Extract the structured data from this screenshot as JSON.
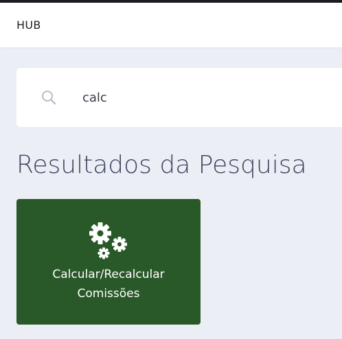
{
  "header": {
    "brand": "HUB"
  },
  "search": {
    "value": "calc",
    "icon": "search-icon"
  },
  "results": {
    "title": "Resultados da Pesquisa",
    "items": [
      {
        "label_line1": "Calcular/Recalcular",
        "label_line2": "Comissões",
        "icon": "gears-icon"
      }
    ]
  },
  "colors": {
    "tile": "#295928",
    "title": "#3d4560",
    "background": "#eceef5"
  }
}
